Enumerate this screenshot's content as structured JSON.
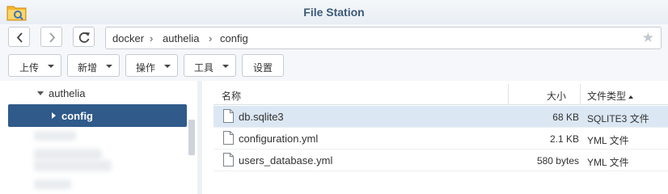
{
  "window": {
    "title": "File Station"
  },
  "breadcrumb": [
    "docker",
    "authelia",
    "config"
  ],
  "toolbar": {
    "upload": "上传",
    "create": "新增",
    "action": "操作",
    "tools": "工具",
    "settings": "设置"
  },
  "tree": {
    "parent": "authelia",
    "selected": "config"
  },
  "list": {
    "columns": {
      "name": "名称",
      "size": "大小",
      "type": "文件类型"
    },
    "rows": [
      {
        "name": "db.sqlite3",
        "size": "68 KB",
        "type": "SQLITE3 文件"
      },
      {
        "name": "configuration.yml",
        "size": "2.1 KB",
        "type": "YML 文件"
      },
      {
        "name": "users_database.yml",
        "size": "580 bytes",
        "type": "YML 文件"
      }
    ]
  },
  "icons": {
    "app": "folder-app-icon",
    "back": "chevron-left-icon",
    "forward": "chevron-right-icon",
    "refresh": "refresh-icon",
    "favorite": "star-icon",
    "file": "file-icon"
  },
  "colors": {
    "title": "#3c5a78",
    "selected_tree": "#2f5a8a",
    "selected_row": "#dbe7f3"
  }
}
